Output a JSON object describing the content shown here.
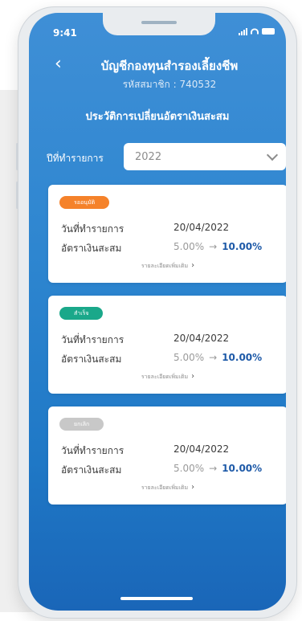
{
  "status_bar": {
    "time": "9:41"
  },
  "header": {
    "title": "บัญชีกองทุนสำรองเลี้ยงชีพ",
    "member_id": "รหัสสมาชิก : 740532",
    "section_title": "ประวัติการเปลี่ยนอัตราเงินสะสม"
  },
  "filter": {
    "label": "ปีที่ทำรายการ",
    "year": "2022"
  },
  "cards": [
    {
      "status": "รออนุมัติ",
      "status_color": "#f5822a",
      "date_label": "วันที่ทำรายการ",
      "date": "20/04/2022",
      "rate_label": "อัตราเงินสะสม",
      "rate_old": "5.00%",
      "arrow": "→",
      "rate_new": "10.00%",
      "details": "รายละเอียดเพิ่มเติม"
    },
    {
      "status": "สำเร็จ",
      "status_color": "#1aa88a",
      "date_label": "วันที่ทำรายการ",
      "date": "20/04/2022",
      "rate_label": "อัตราเงินสะสม",
      "rate_old": "5.00%",
      "arrow": "→",
      "rate_new": "10.00%",
      "details": "รายละเอียดเพิ่มเติม"
    },
    {
      "status": "ยกเลิก",
      "status_color": "#c8c8c8",
      "date_label": "วันที่ทำรายการ",
      "date": "20/04/2022",
      "rate_label": "อัตราเงินสะสม",
      "rate_old": "5.00%",
      "arrow": "→",
      "rate_new": "10.00%",
      "details": "รายละเอียดเพิ่มเติม"
    }
  ],
  "icons": {
    "back": "back-arrow-icon",
    "dropdown": "chevron-down-icon",
    "details": "chevron-right-icon"
  }
}
